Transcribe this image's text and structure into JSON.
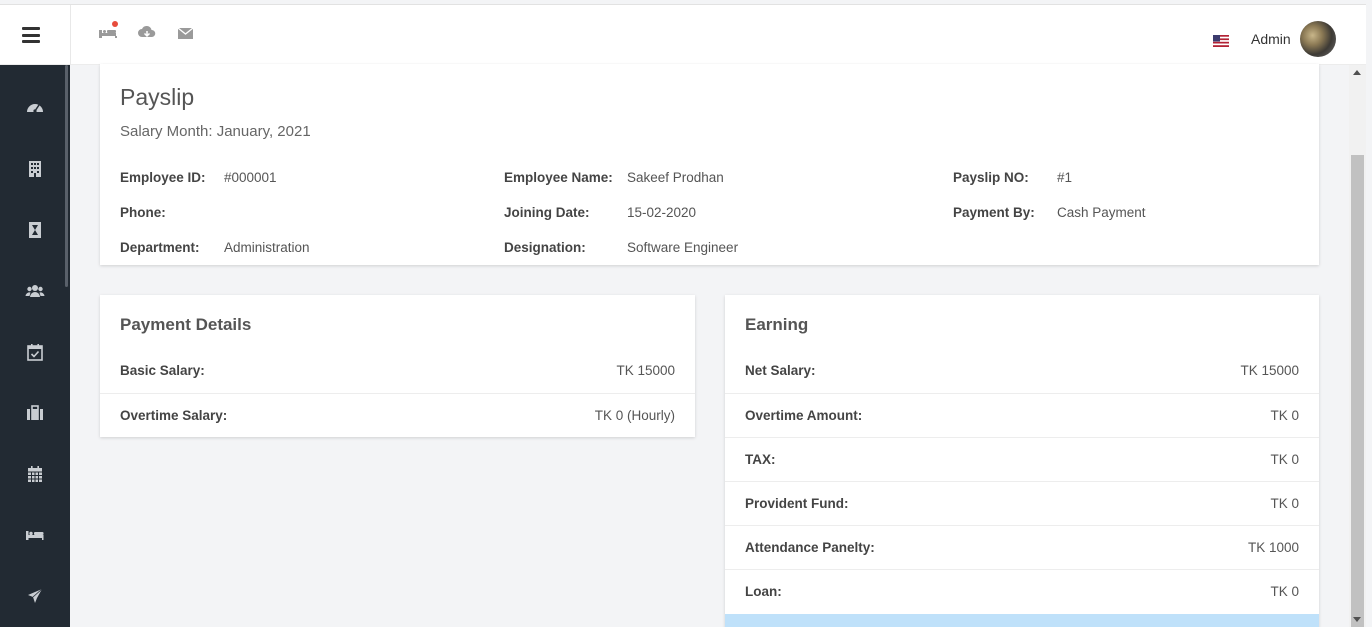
{
  "topbar": {
    "admin_name": "Admin",
    "icons": [
      "bed-icon",
      "cloud-download-icon",
      "envelope-icon"
    ],
    "flag": "us-flag-icon"
  },
  "sidebar": {
    "items": [
      "dashboard-icon",
      "building-icon",
      "hourglass-icon",
      "users-icon",
      "calendar-check-icon",
      "briefcase-icon",
      "calendar-icon",
      "bed-icon",
      "plane-icon"
    ]
  },
  "payslip": {
    "title": "Payslip",
    "salary_month": "Salary Month: January, 2021",
    "employee_id_label": "Employee ID:",
    "employee_id": "#000001",
    "phone_label": "Phone:",
    "phone": "",
    "department_label": "Department:",
    "department": "Administration",
    "employee_name_label": "Employee Name:",
    "employee_name": "Sakeef Prodhan",
    "joining_date_label": "Joining Date:",
    "joining_date": "15-02-2020",
    "designation_label": "Designation:",
    "designation": "Software Engineer",
    "payslip_no_label": "Payslip NO:",
    "payslip_no": "#1",
    "payment_by_label": "Payment By:",
    "payment_by": "Cash Payment"
  },
  "payment_details": {
    "title": "Payment Details",
    "rows": [
      {
        "label": "Basic Salary:",
        "value": "TK 15000"
      },
      {
        "label": "Overtime Salary:",
        "value": "TK 0 (Hourly)"
      }
    ]
  },
  "earning": {
    "title": "Earning",
    "rows": [
      {
        "label": "Net Salary:",
        "value": "TK 15000"
      },
      {
        "label": "Overtime Amount:",
        "value": "TK 0"
      },
      {
        "label": "TAX:",
        "value": "TK 0"
      },
      {
        "label": "Provident Fund:",
        "value": "TK 0"
      },
      {
        "label": "Attendance Panelty:",
        "value": "TK 1000"
      },
      {
        "label": "Loan:",
        "value": "TK 0"
      }
    ]
  },
  "colors": {
    "sidebar_bg": "#222a33",
    "highlight_row": "#bfe1fa",
    "notification_dot": "#e74c3c"
  }
}
